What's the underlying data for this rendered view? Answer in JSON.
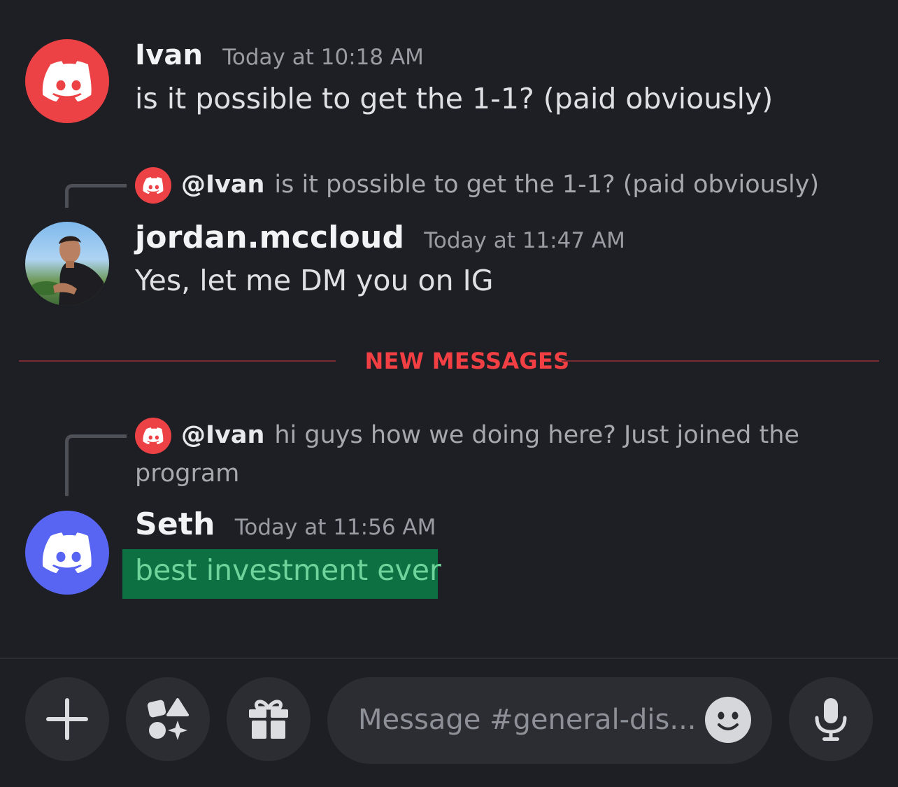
{
  "messages": [
    {
      "username": "Ivan",
      "timestamp": "Today at 10:18 AM",
      "content": "is it possible to get the 1-1? (paid obviously)",
      "avatar": "discord-logo-red"
    },
    {
      "reply": {
        "user": "@Ivan",
        "text": "is it possible to get the 1-1? (paid obviously)"
      },
      "username": "jordan.mccloud",
      "timestamp": "Today at 11:47 AM",
      "content": "Yes, let me DM you on IG",
      "avatar": "profile-photo"
    },
    {
      "reply": {
        "user": "@Ivan",
        "text": "hi guys how we doing here? Just joined the program"
      },
      "username": "Seth",
      "timestamp": "Today at 11:56 AM",
      "content": "best investment ever",
      "avatar": "discord-logo-blurple"
    }
  ],
  "divider": {
    "label": "NEW MESSAGES"
  },
  "composer": {
    "placeholder": "Message #general-dis...",
    "buttons": [
      "plus-icon",
      "apps-icon",
      "gift-icon",
      "emoji-icon",
      "microphone-icon"
    ]
  },
  "colors": {
    "background": "#1e1f24",
    "new_messages": "#f23f43",
    "highlight": "#0d7043",
    "discord_red": "#ed4245",
    "blurple": "#5865f2"
  }
}
